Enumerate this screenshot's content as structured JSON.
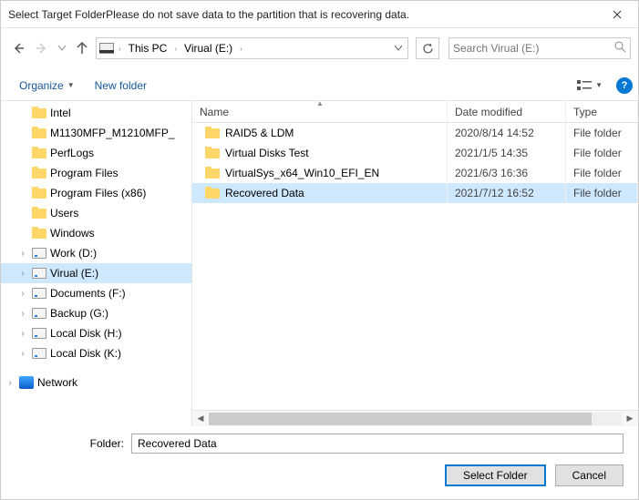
{
  "title": "Select Target FolderPlease do not save data to the partition that is recovering data.",
  "breadcrumb": {
    "root": "This PC",
    "leaf": "Virual (E:)"
  },
  "search": {
    "placeholder": "Search Virual (E:)"
  },
  "toolbar": {
    "organize": "Organize",
    "newfolder": "New folder"
  },
  "tree": {
    "items": [
      {
        "label": "Intel",
        "kind": "folder",
        "indent": 1
      },
      {
        "label": "M1130MFP_M1210MFP_",
        "kind": "folder",
        "indent": 1
      },
      {
        "label": "PerfLogs",
        "kind": "folder",
        "indent": 1
      },
      {
        "label": "Program Files",
        "kind": "folder",
        "indent": 1
      },
      {
        "label": "Program Files (x86)",
        "kind": "folder",
        "indent": 1
      },
      {
        "label": "Users",
        "kind": "folder",
        "indent": 1
      },
      {
        "label": "Windows",
        "kind": "folder",
        "indent": 1
      },
      {
        "label": "Work (D:)",
        "kind": "drive",
        "indent": 0,
        "exp": true
      },
      {
        "label": "Virual (E:)",
        "kind": "drive",
        "indent": 0,
        "exp": true,
        "selected": true
      },
      {
        "label": "Documents (F:)",
        "kind": "drive",
        "indent": 0,
        "exp": true
      },
      {
        "label": "Backup (G:)",
        "kind": "drive",
        "indent": 0,
        "exp": true
      },
      {
        "label": "Local Disk (H:)",
        "kind": "drive",
        "indent": 0,
        "exp": true
      },
      {
        "label": "Local Disk (K:)",
        "kind": "drive",
        "indent": 0,
        "exp": true
      },
      {
        "label": "",
        "kind": "spacer"
      },
      {
        "label": "Network",
        "kind": "network",
        "indent": -1,
        "exp": true
      }
    ]
  },
  "columns": {
    "name": "Name",
    "date": "Date modified",
    "type": "Type"
  },
  "rows": [
    {
      "name": "RAID5 & LDM",
      "date": "2020/8/14 14:52",
      "type": "File folder"
    },
    {
      "name": "Virtual Disks Test",
      "date": "2021/1/5 14:35",
      "type": "File folder"
    },
    {
      "name": "VirtualSys_x64_Win10_EFI_EN",
      "date": "2021/6/3 16:36",
      "type": "File folder"
    },
    {
      "name": "Recovered Data",
      "date": "2021/7/12 16:52",
      "type": "File folder",
      "selected": true
    }
  ],
  "folderLabel": "Folder:",
  "folderValue": "Recovered Data",
  "buttons": {
    "select": "Select Folder",
    "cancel": "Cancel"
  }
}
